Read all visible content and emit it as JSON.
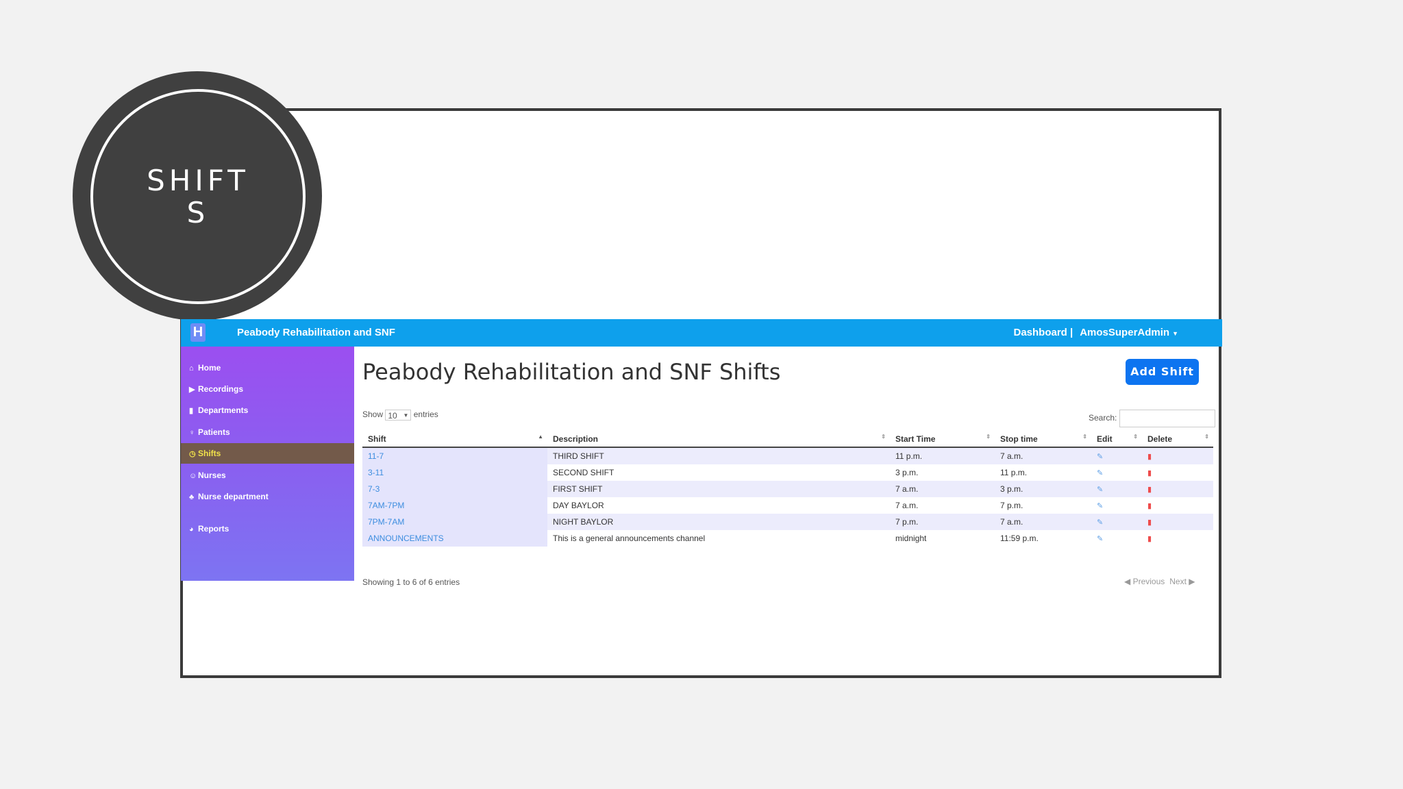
{
  "slide": {
    "title": "SHIFTS"
  },
  "navbar": {
    "logo": "H",
    "brand": "Peabody Rehabilitation and SNF",
    "dashboard": "Dashboard |",
    "user": "AmosSuperAdmin"
  },
  "sidebar": {
    "items": [
      {
        "icon": "home-icon",
        "glyph": "⌂",
        "label": "Home"
      },
      {
        "icon": "play-icon",
        "glyph": "▶",
        "label": "Recordings"
      },
      {
        "icon": "building-icon",
        "glyph": "▮",
        "label": "Departments"
      },
      {
        "icon": "wheelchair-icon",
        "glyph": "♀",
        "label": "Patients"
      },
      {
        "icon": "clock-icon",
        "glyph": "◷",
        "label": "Shifts"
      },
      {
        "icon": "user-md-icon",
        "glyph": "☺",
        "label": "Nurses"
      },
      {
        "icon": "users-icon",
        "glyph": "♣",
        "label": "Nurse department"
      },
      {
        "icon": "pie-chart-icon",
        "glyph": "◕",
        "label": "Reports"
      }
    ]
  },
  "main": {
    "title": "Peabody Rehabilitation and SNF Shifts",
    "add_button": "Add Shift",
    "show_label": "Show",
    "entries_value": "10",
    "entries_label": "entries",
    "search_label": "Search:",
    "info": "Showing 1 to 6 of 6 entries",
    "previous": "Previous",
    "next": "Next"
  },
  "table": {
    "columns": [
      "Shift",
      "Description",
      "Start Time",
      "Stop time",
      "Edit",
      "Delete"
    ],
    "rows": [
      {
        "shift": "11-7",
        "description": "THIRD SHIFT",
        "start": "11 p.m.",
        "stop": "7 a.m."
      },
      {
        "shift": "3-11",
        "description": "SECOND SHIFT",
        "start": "3 p.m.",
        "stop": "11 p.m."
      },
      {
        "shift": "7-3",
        "description": "FIRST SHIFT",
        "start": "7 a.m.",
        "stop": "3 p.m."
      },
      {
        "shift": "7AM-7PM",
        "description": "DAY BAYLOR",
        "start": "7 a.m.",
        "stop": "7 p.m."
      },
      {
        "shift": "7PM-7AM",
        "description": "NIGHT BAYLOR",
        "start": "7 p.m.",
        "stop": "7 a.m."
      },
      {
        "shift": "ANNOUNCEMENTS",
        "description": "This is a general announcements channel",
        "start": "midnight",
        "stop": "11:59 p.m."
      }
    ]
  },
  "colors": {
    "navbar": "#0ea0ec",
    "sidebar_top": "#9b4ff0",
    "sidebar_bottom": "#7d74f2",
    "active_item": "#735a4a",
    "button": "#0d74f0",
    "link": "#3c8ddf",
    "delete": "#ee4c4c"
  }
}
